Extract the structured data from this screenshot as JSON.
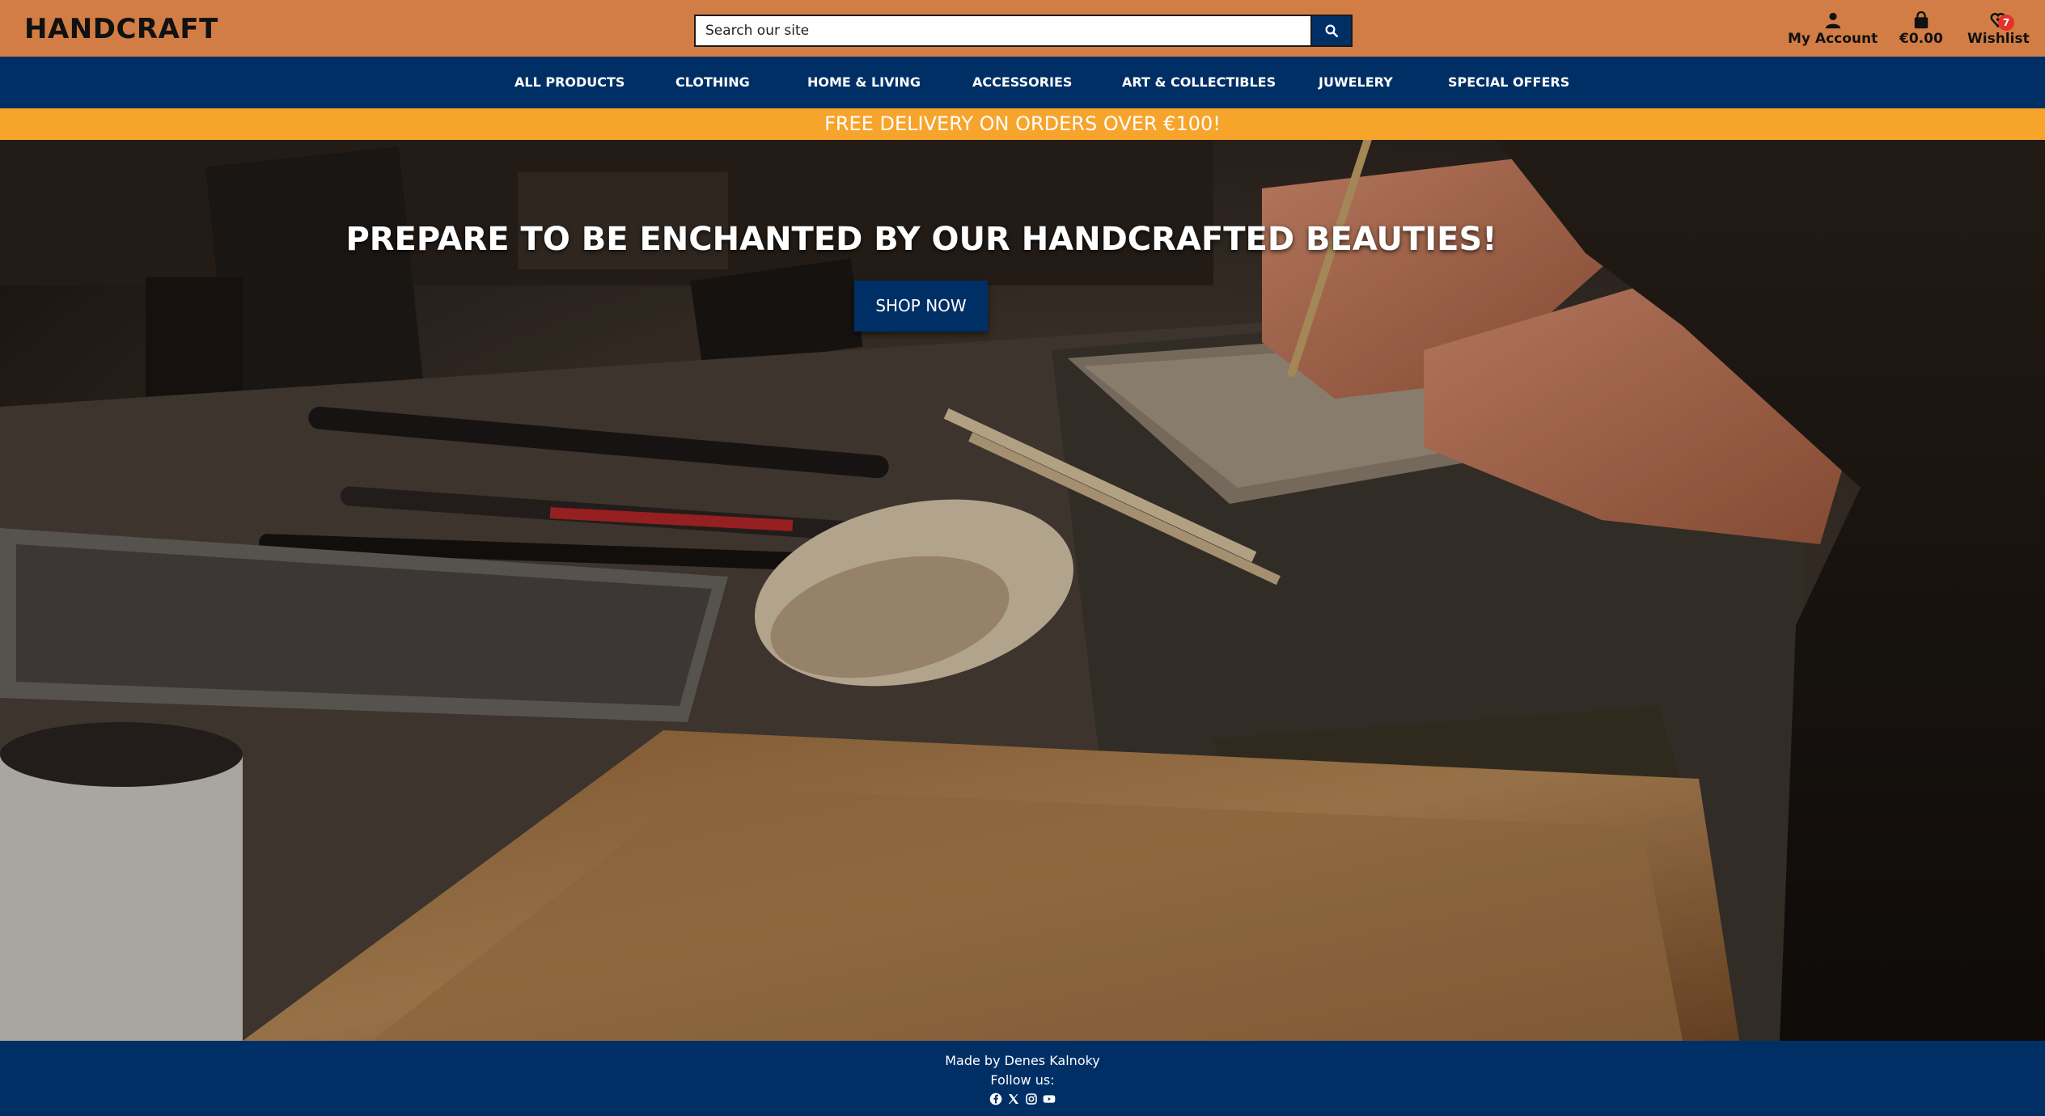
{
  "header": {
    "logo": "HANDCRAFT",
    "search_placeholder": "Search our site",
    "account_label": "My Account",
    "bag_total": "€0.00",
    "wishlist_label": "Wishlist",
    "wishlist_count": "7"
  },
  "nav": {
    "items": [
      {
        "label": "ALL PRODUCTS"
      },
      {
        "label": "CLOTHING"
      },
      {
        "label": "HOME & LIVING"
      },
      {
        "label": "ACCESSORIES"
      },
      {
        "label": "ART & COLLECTIBLES"
      },
      {
        "label": "JUWELERY"
      },
      {
        "label": "SPECIAL OFFERS"
      }
    ]
  },
  "promo": {
    "text": "FREE DELIVERY ON ORDERS OVER €100!"
  },
  "hero": {
    "title": "PREPARE TO BE ENCHANTED BY OUR HANDCRAFTED BEAUTIES!",
    "cta": "SHOP NOW"
  },
  "footer": {
    "credit": "Made by Denes Kalnoky",
    "follow": "Follow us:",
    "social_icons": [
      "facebook-icon",
      "x-icon",
      "instagram-icon",
      "youtube-icon"
    ]
  },
  "colors": {
    "header_bg": "#d27d45",
    "navy": "#002f66",
    "promo_bg": "#f6a42b",
    "badge": "#e5312b"
  }
}
